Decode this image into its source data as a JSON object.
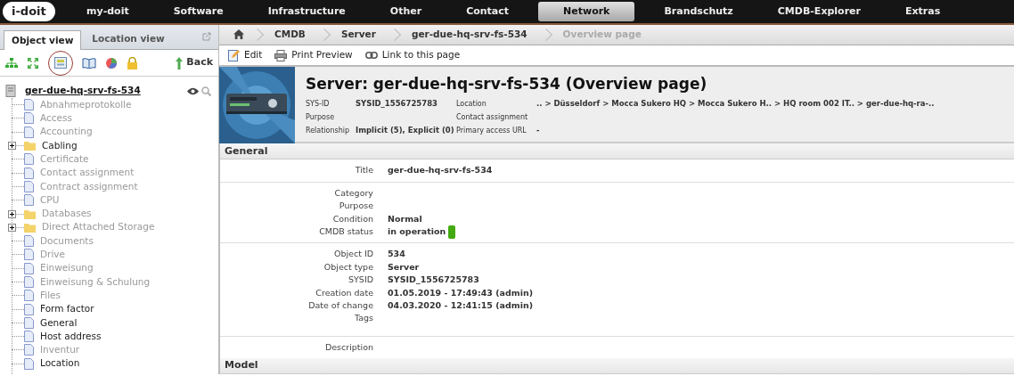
{
  "logo": {
    "text": "i-doit"
  },
  "nav": [
    {
      "label": "my-doit",
      "selected": false
    },
    {
      "label": "Software",
      "selected": false
    },
    {
      "label": "Infrastructure",
      "selected": false
    },
    {
      "label": "Other",
      "selected": false
    },
    {
      "label": "Contact",
      "selected": false
    },
    {
      "label": "Network",
      "selected": true
    },
    {
      "label": "Brandschutz",
      "selected": false
    },
    {
      "label": "CMDB-Explorer",
      "selected": false
    },
    {
      "label": "Extras",
      "selected": false
    }
  ],
  "left_tabs": [
    {
      "label": "Object view",
      "selected": true
    },
    {
      "label": "Location view",
      "selected": false
    }
  ],
  "left_toolbar": {
    "back": "Back"
  },
  "tree": {
    "title": "ger-due-hq-srv-fs-534",
    "children": [
      {
        "label": "Abnahmeprotokolle",
        "kind": "file",
        "enabled": false
      },
      {
        "label": "Access",
        "kind": "file",
        "enabled": false
      },
      {
        "label": "Accounting",
        "kind": "file",
        "enabled": false
      },
      {
        "label": "Cabling",
        "kind": "folder",
        "enabled": true
      },
      {
        "label": "Certificate",
        "kind": "file",
        "enabled": false
      },
      {
        "label": "Contact assignment",
        "kind": "file",
        "enabled": false
      },
      {
        "label": "Contract assignment",
        "kind": "file",
        "enabled": false
      },
      {
        "label": "CPU",
        "kind": "file",
        "enabled": false
      },
      {
        "label": "Databases",
        "kind": "folder",
        "enabled": false
      },
      {
        "label": "Direct Attached Storage",
        "kind": "folder",
        "enabled": false
      },
      {
        "label": "Documents",
        "kind": "file",
        "enabled": false
      },
      {
        "label": "Drive",
        "kind": "file",
        "enabled": false
      },
      {
        "label": "Einweisung",
        "kind": "file",
        "enabled": false
      },
      {
        "label": "Einweisung & Schulung",
        "kind": "file",
        "enabled": false
      },
      {
        "label": "Files",
        "kind": "file",
        "enabled": false
      },
      {
        "label": "Form factor",
        "kind": "file",
        "enabled": true
      },
      {
        "label": "General",
        "kind": "file",
        "enabled": true
      },
      {
        "label": "Host address",
        "kind": "file",
        "enabled": true
      },
      {
        "label": "Inventur",
        "kind": "file",
        "enabled": false
      },
      {
        "label": "Location",
        "kind": "file",
        "enabled": true
      }
    ]
  },
  "breadcrumb": [
    "CMDB",
    "Server",
    "ger-due-hq-srv-fs-534",
    "Overview page"
  ],
  "actions": [
    {
      "label": "Edit",
      "kind": "edit"
    },
    {
      "label": "Print Preview",
      "kind": "print"
    },
    {
      "label": "Link to this page",
      "kind": "link"
    }
  ],
  "header": {
    "title": "Server: ger-due-hq-srv-fs-534 (Overview page)",
    "left": [
      {
        "label": "SYS-ID",
        "value": "SYSID_1556725783"
      },
      {
        "label": "Purpose"
      },
      {
        "label": "Relationship",
        "value": "Implicit (5), Explicit (0)"
      }
    ],
    "right": [
      {
        "label": "Location",
        "value": ".. > Düsseldorf > Mocca Sukero HQ > Mocca Sukero H.. > HQ room 002 IT.. > ger-due-hq-ra-.."
      },
      {
        "label": "Contact assignment"
      },
      {
        "label": "Primary access URL",
        "value": "-"
      }
    ]
  },
  "sections": [
    {
      "title": "General",
      "groups": [
        [
          {
            "label": "Title",
            "value": "ger-due-hq-srv-fs-534"
          }
        ],
        [
          {
            "label": "Category"
          },
          {
            "label": "Purpose"
          },
          {
            "label": "Condition",
            "value": "Normal"
          },
          {
            "label": "CMDB status",
            "value": "in operation",
            "color": "#44aa11"
          }
        ],
        [
          {
            "label": "Object ID",
            "value": "534"
          },
          {
            "label": "Object type",
            "value": "Server"
          },
          {
            "label": "SYSID",
            "value": "SYSID_1556725783"
          },
          {
            "label": "Creation date",
            "value": "01.05.2019 - 17:49:43 (admin)"
          },
          {
            "label": "Date of change",
            "value": "04.03.2020 - 12:41:15 (admin)"
          },
          {
            "label": "Tags"
          }
        ],
        [
          {
            "label": "Description"
          }
        ]
      ]
    },
    {
      "title": "Model"
    }
  ]
}
